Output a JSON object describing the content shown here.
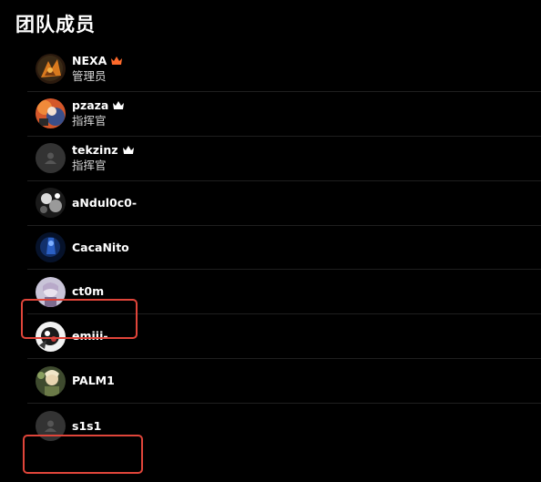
{
  "section_title": "团队成员",
  "colors": {
    "background": "#000000",
    "crown_leader": "#ff6a2b",
    "crown_default": "#ffffff",
    "highlight": "#e0453a"
  },
  "members": [
    {
      "name": "NEXA",
      "role": "管理员",
      "crown": "orange",
      "avatar": "avatar-nexa"
    },
    {
      "name": "pzaza",
      "role": "指挥官",
      "crown": "white",
      "avatar": "avatar-pzaza"
    },
    {
      "name": "tekzinz",
      "role": "指挥官",
      "crown": "white",
      "avatar": "avatar-default"
    },
    {
      "name": "aNdul0c0-",
      "role": "",
      "crown": "",
      "avatar": "avatar-andul"
    },
    {
      "name": "CacaNito",
      "role": "",
      "crown": "",
      "avatar": "avatar-cacanito"
    },
    {
      "name": "ct0m",
      "role": "",
      "crown": "",
      "avatar": "avatar-ct0m",
      "highlighted": true
    },
    {
      "name": "emiii-",
      "role": "",
      "crown": "",
      "avatar": "avatar-emiii"
    },
    {
      "name": "PALM1",
      "role": "",
      "crown": "",
      "avatar": "avatar-palm1"
    },
    {
      "name": "s1s1",
      "role": "",
      "crown": "",
      "avatar": "avatar-default",
      "highlighted": true
    }
  ]
}
